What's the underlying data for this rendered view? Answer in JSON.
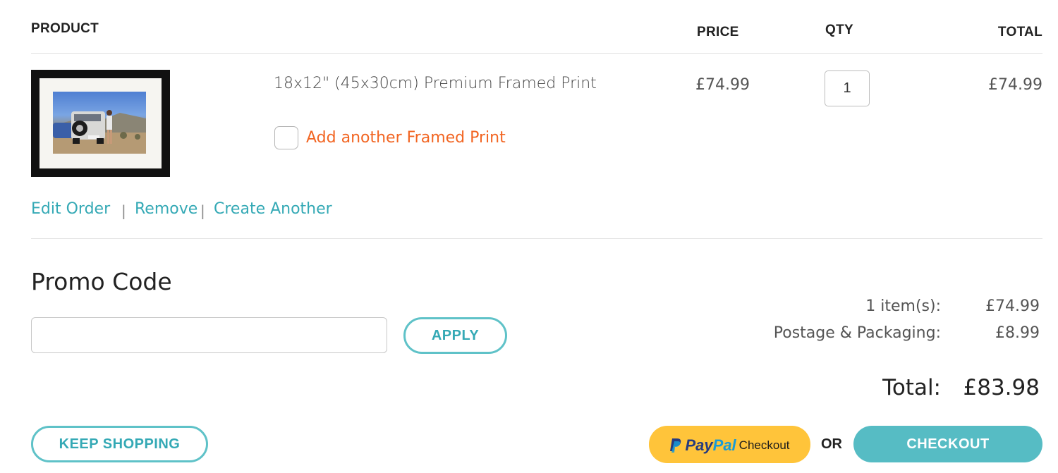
{
  "table": {
    "headers": {
      "product": "PRODUCT",
      "price": "PRICE",
      "qty": "QTY",
      "total": "TOTAL"
    }
  },
  "item": {
    "name": "18x12\" (45x30cm) Premium Framed Print",
    "price": "£74.99",
    "qty": "1",
    "total": "£74.99",
    "add_another_label": "Add another Framed Print",
    "add_another_checked": false
  },
  "item_actions": {
    "edit": "Edit Order",
    "separator": "|",
    "remove": "Remove",
    "create": "Create Another"
  },
  "promo": {
    "title": "Promo Code",
    "value": "",
    "apply_label": "APPLY"
  },
  "summary": {
    "items_label": "1 item(s):",
    "items_value": "£74.99",
    "postage_label": "Postage & Packaging:",
    "postage_value": "£8.99",
    "total_label": "Total:",
    "total_value": "£83.98"
  },
  "actions": {
    "keep_shopping": "KEEP SHOPPING",
    "paypal_brand_pay": "Pay",
    "paypal_brand_pal": "Pal",
    "paypal_text": "Checkout",
    "or": "OR",
    "checkout": "CHECKOUT"
  },
  "colors": {
    "accent_teal": "#56bcc4",
    "link_teal": "#34a9b5",
    "orange": "#f26522",
    "paypal_yellow": "#ffc43a",
    "paypal_blue_dark": "#253b80",
    "paypal_blue_light": "#179bd7"
  }
}
